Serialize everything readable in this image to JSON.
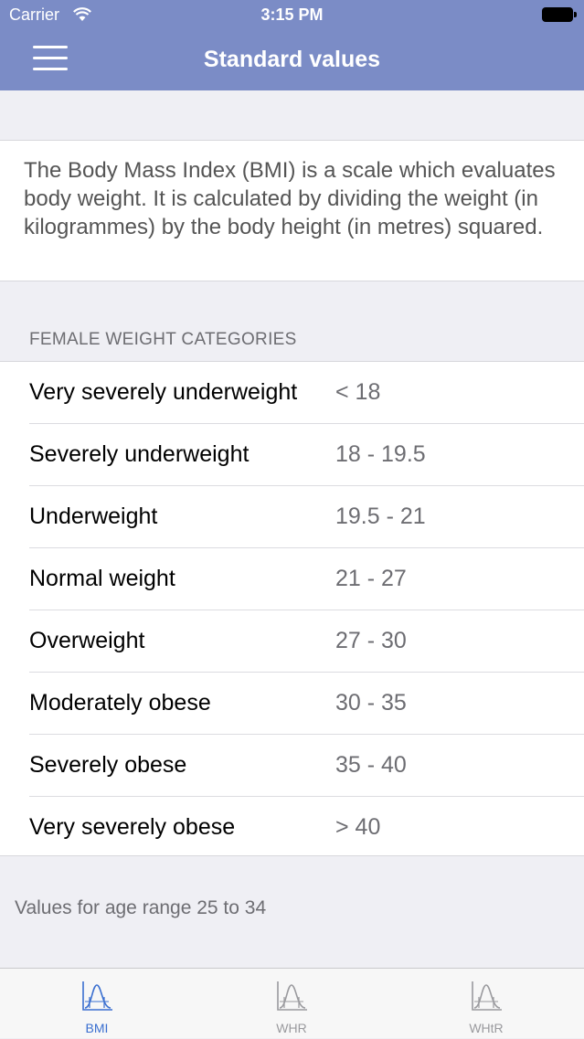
{
  "status_bar": {
    "carrier": "Carrier",
    "time": "3:15 PM"
  },
  "nav": {
    "title": "Standard values"
  },
  "description": "The Body Mass Index (BMI) is a scale which evaluates body weight. It is calculated by dividing the weight (in kilogrammes) by the body height (in metres) squared.",
  "section_header": "FEMALE WEIGHT CATEGORIES",
  "categories": [
    {
      "name": "Very severely underweight",
      "range": "< 18"
    },
    {
      "name": "Severely underweight",
      "range": "18 - 19.5"
    },
    {
      "name": "Underweight",
      "range": "19.5 - 21"
    },
    {
      "name": "Normal weight",
      "range": "21 - 27"
    },
    {
      "name": "Overweight",
      "range": "27 - 30"
    },
    {
      "name": "Moderately obese",
      "range": "30 - 35"
    },
    {
      "name": "Severely obese",
      "range": "35 - 40"
    },
    {
      "name": "Very severely obese",
      "range": "> 40"
    }
  ],
  "footer_note": "Values for age range 25 to 34",
  "tabs": [
    {
      "label": "BMI",
      "icon": "bmi-chart-icon",
      "active": true
    },
    {
      "label": "WHR",
      "icon": "whr-chart-icon",
      "active": false
    },
    {
      "label": "WHtR",
      "icon": "whtr-chart-icon",
      "active": false
    }
  ],
  "colors": {
    "nav": "#7b8cc6",
    "active_tab": "#3a6fd0",
    "inactive_tab": "#9a9a9e"
  }
}
